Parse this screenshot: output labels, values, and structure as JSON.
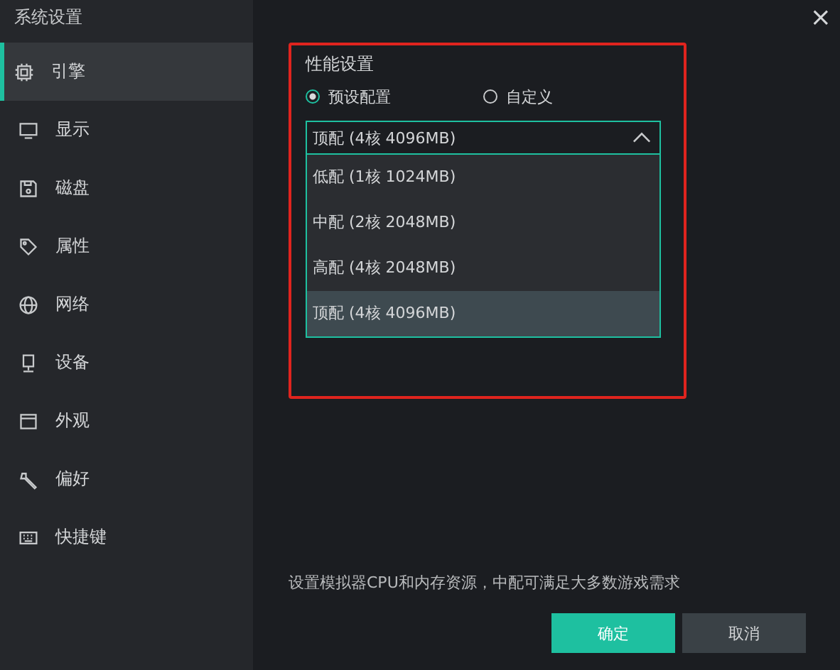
{
  "window": {
    "title": "系统设置",
    "close": "×"
  },
  "sidebar": {
    "items": [
      {
        "label": "引擎",
        "selected": true
      },
      {
        "label": "显示",
        "selected": false
      },
      {
        "label": "磁盘",
        "selected": false
      },
      {
        "label": "属性",
        "selected": false
      },
      {
        "label": "网络",
        "selected": false
      },
      {
        "label": "设备",
        "selected": false
      },
      {
        "label": "外观",
        "selected": false
      },
      {
        "label": "偏好",
        "selected": false
      },
      {
        "label": "快捷键",
        "selected": false
      }
    ]
  },
  "performance": {
    "title": "性能设置",
    "radios": [
      {
        "label": "预设配置",
        "selected": true
      },
      {
        "label": "自定义",
        "selected": false
      }
    ],
    "dropdown": {
      "value": "顶配 (4核 4096MB)",
      "expanded": true,
      "options": [
        {
          "label": "低配 (1核 1024MB)",
          "selected": false
        },
        {
          "label": "中配 (2核 2048MB)",
          "selected": false
        },
        {
          "label": "高配 (4核 2048MB)",
          "selected": false
        },
        {
          "label": "顶配 (4核 4096MB)",
          "selected": true
        }
      ]
    }
  },
  "hint": "设置模拟器CPU和内存资源，中配可满足大多数游戏需求",
  "buttons": [
    {
      "label": "确定",
      "kind": "primary"
    },
    {
      "label": "取消",
      "kind": "secondary"
    }
  ]
}
